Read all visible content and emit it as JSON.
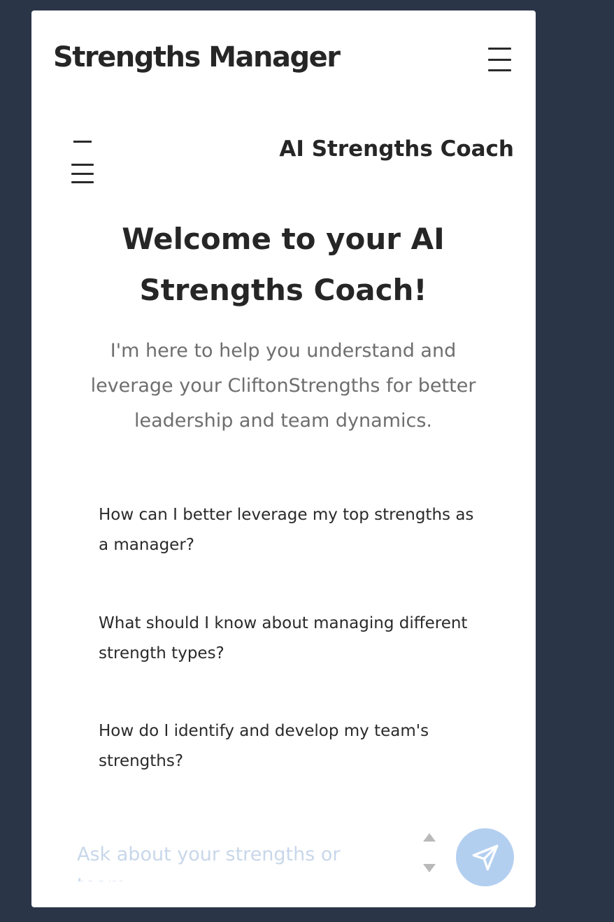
{
  "header": {
    "app_title": "Strengths Manager"
  },
  "coach": {
    "title": "AI Strengths Coach"
  },
  "welcome": {
    "heading": "Welcome to your AI Strengths Coach!",
    "subtitle": "I'm here to help you understand and leverage your CliftonStrengths for better leadership and team dynamics."
  },
  "suggestions": [
    {
      "text": "How can I better leverage my top strengths as a manager?"
    },
    {
      "text": "What should I know about managing different strength types?"
    },
    {
      "text": "How do I identify and develop my team's strengths?"
    }
  ],
  "input": {
    "placeholder": "Ask about your strengths or team...",
    "value": ""
  },
  "icons": {
    "top_menu": "menu-icon",
    "side_menu": "menu-icon",
    "send": "send-icon",
    "scroll_up": "scroll-up-icon",
    "scroll_down": "scroll-down-icon"
  },
  "colors": {
    "background": "#2b3548",
    "panel": "#ffffff",
    "send_button": "#b3cff0",
    "placeholder": "#c8d7ea"
  }
}
